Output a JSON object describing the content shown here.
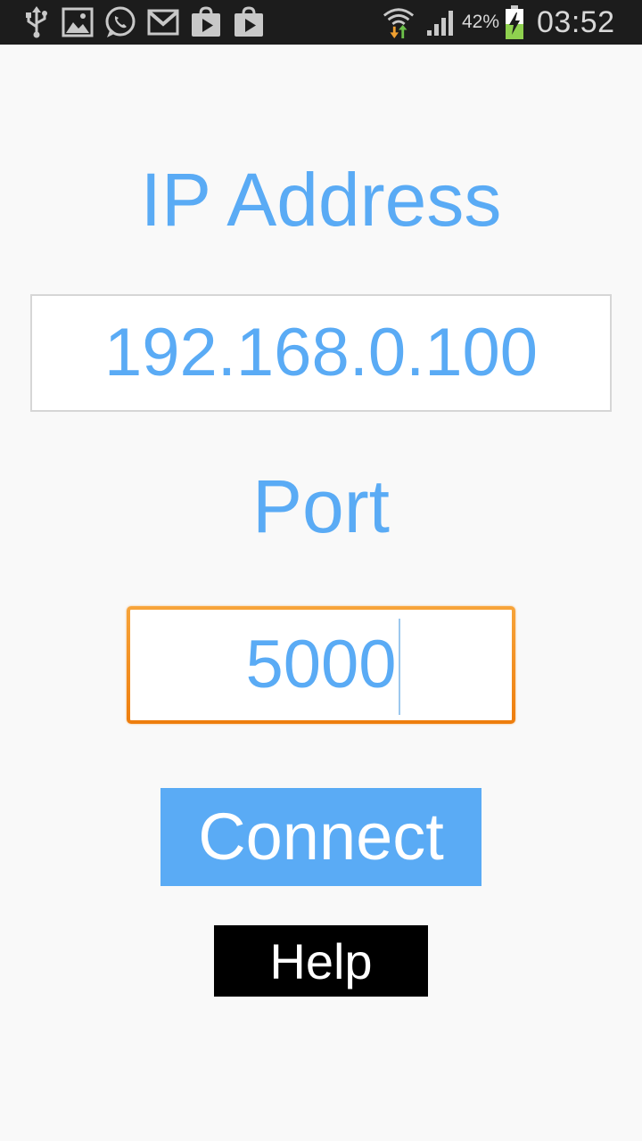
{
  "status_bar": {
    "notification_icons": [
      "usb-icon",
      "gallery-icon",
      "whatsapp-icon",
      "gmail-icon",
      "play-store-icon",
      "play-store-icon"
    ],
    "wifi_icon": "wifi-data-transfer-icon",
    "signal_icon": "signal-strength-icon",
    "battery_percent": "42%",
    "battery_icon": "battery-charging-icon",
    "time": "03:52",
    "background_color": "#1c1c1c"
  },
  "form": {
    "ip_label": "IP Address",
    "ip_value": "192.168.0.100",
    "port_label": "Port",
    "port_value": "5000",
    "port_focused": true,
    "connect_label": "Connect",
    "help_label": "Help"
  },
  "colors": {
    "accent": "#5aabf5",
    "focus_border": "#f39122",
    "background": "#f9f9f9",
    "help_button": "#000000"
  }
}
